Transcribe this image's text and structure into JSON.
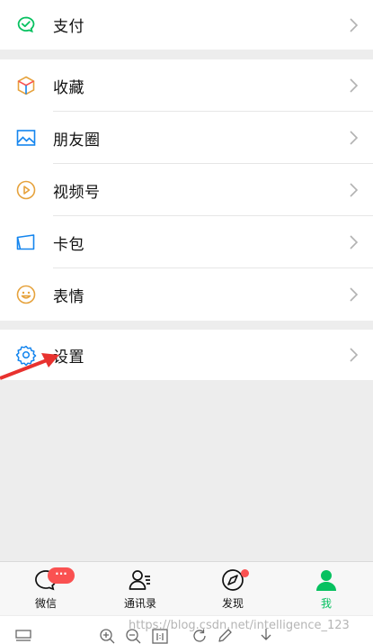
{
  "menu": {
    "pay": {
      "label": "支付",
      "icon": "pay-icon"
    },
    "favorites": {
      "label": "收藏",
      "icon": "favorites-cube-icon"
    },
    "moments": {
      "label": "朋友圈",
      "icon": "moments-image-icon"
    },
    "channels": {
      "label": "视频号",
      "icon": "channels-play-icon"
    },
    "cards": {
      "label": "卡包",
      "icon": "card-wallet-icon"
    },
    "stickers": {
      "label": "表情",
      "icon": "sticker-smile-icon"
    },
    "settings": {
      "label": "设置",
      "icon": "gear-icon"
    }
  },
  "tabbar": {
    "chats": {
      "label": "微信",
      "badge": "···"
    },
    "contacts": {
      "label": "通讯录"
    },
    "discover": {
      "label": "发现"
    },
    "me": {
      "label": "我"
    }
  },
  "watermark": "https://blog.csdn.net/intelligence_123",
  "colors": {
    "accent_green": "#07c160",
    "badge_red": "#fa5151",
    "background": "#ededed",
    "arrow_red": "#e8322f"
  }
}
